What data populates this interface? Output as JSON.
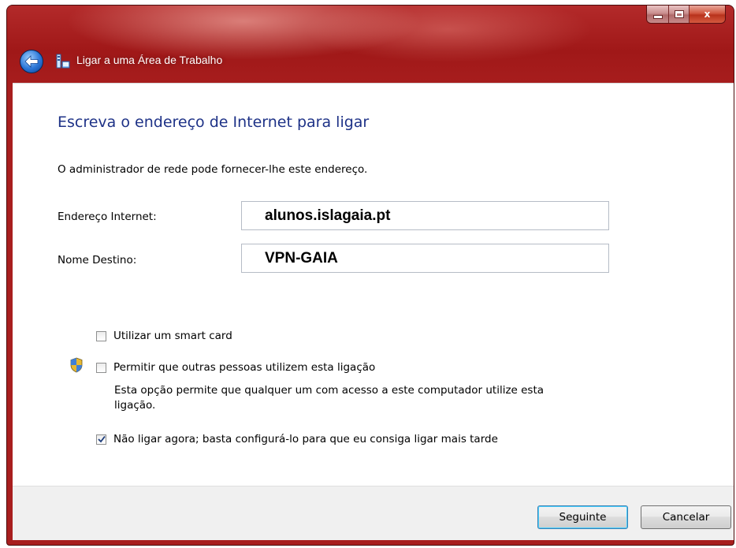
{
  "window": {
    "title": "Ligar a uma Área de Trabalho",
    "controls": {
      "minimize_glyph": "",
      "maximize_glyph": "",
      "close_glyph": "x"
    }
  },
  "main": {
    "heading": "Escreva o endereço de Internet para ligar",
    "info": "O administrador de rede pode fornecer-lhe este endereço.",
    "fields": [
      {
        "label": "Endereço Internet:",
        "value": "alunos.islagaia.pt"
      },
      {
        "label": "Nome Destino:",
        "value": "VPN-GAIA"
      }
    ],
    "options": [
      {
        "label": "Utilizar um smart card",
        "checked": false
      },
      {
        "label": "Permitir que outras pessoas utilizem esta ligação",
        "checked": false,
        "description": "Esta opção permite que qualquer um com acesso a este computador utilize esta ligação."
      },
      {
        "label": "Não ligar agora; basta configurá-lo para que eu consiga ligar mais tarde",
        "checked": true
      }
    ]
  },
  "footer": {
    "next_label": "Seguinte",
    "cancel_label": "Cancelar"
  },
  "icons": {
    "back": "back-arrow-icon",
    "app": "network-connection-icon",
    "shield": "uac-shield-icon"
  },
  "colors": {
    "titlebar": "#a81e1e",
    "heading": "#1e3287",
    "footer_bg": "#f0f0f0"
  }
}
